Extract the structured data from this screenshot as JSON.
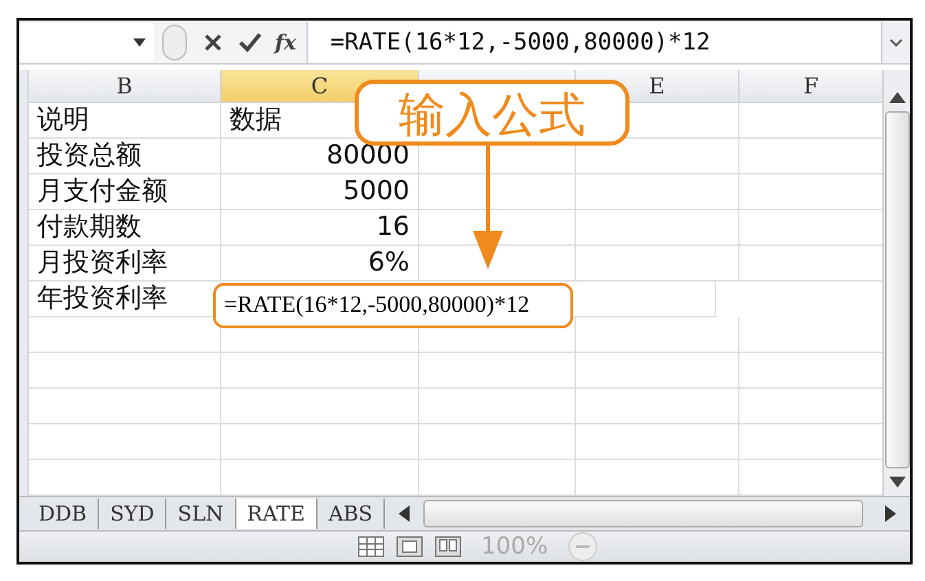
{
  "formula_bar": {
    "function_label": "fx",
    "formula": "=RATE(16*12,-5000,80000)*12"
  },
  "columns": [
    {
      "label": "B",
      "selected": false
    },
    {
      "label": "C",
      "selected": true
    },
    {
      "selected": false
    },
    {
      "label": "E",
      "selected": false
    },
    {
      "label": "F",
      "selected": false
    }
  ],
  "rows": [
    {
      "label": "说明",
      "value": "数据",
      "kind": "text",
      "editing": false
    },
    {
      "label": "投资总额",
      "value": "80000",
      "kind": "number",
      "editing": false
    },
    {
      "label": "月支付金额",
      "value": "5000",
      "kind": "number",
      "editing": false
    },
    {
      "label": "付款期数",
      "value": "16",
      "kind": "number",
      "editing": false
    },
    {
      "label": "月投资利率",
      "value": "6%",
      "kind": "number",
      "editing": false
    },
    {
      "label": "年投资利率",
      "value": "=RATE(16*12,-5000,80000)*12",
      "kind": "text",
      "editing": true
    }
  ],
  "sheet_tabs": [
    {
      "label": "DDB",
      "selected": false
    },
    {
      "label": "SYD",
      "selected": false
    },
    {
      "label": "SLN",
      "selected": false
    },
    {
      "label": "RATE",
      "selected": true
    },
    {
      "label": "ABS",
      "selected": false
    }
  ],
  "status_bar": {
    "zoom": "100%"
  },
  "callout": {
    "text": "输入公式"
  }
}
